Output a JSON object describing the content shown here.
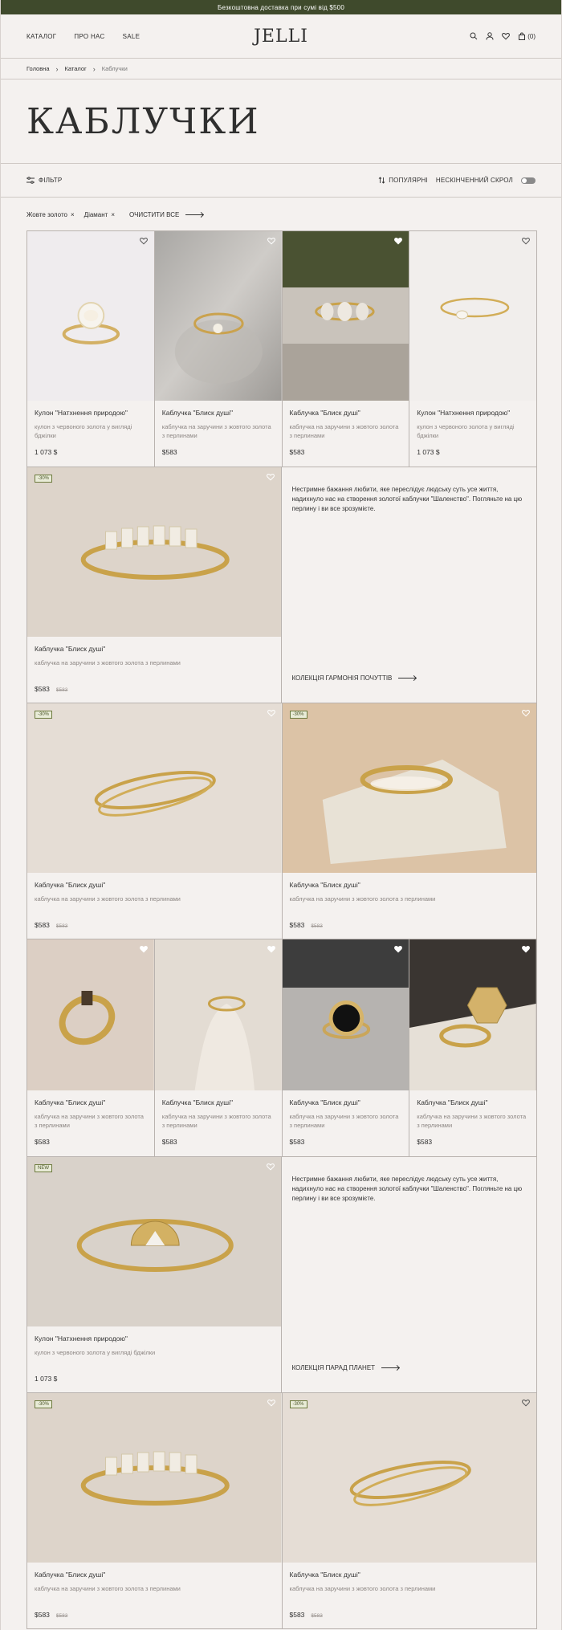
{
  "topbar": {
    "text": "Безкоштовна доставка при сумі від $500"
  },
  "header": {
    "nav": [
      "КАТАЛОГ",
      "ПРО НАС",
      "SALE"
    ],
    "logo": "JELLI",
    "cart_count": "(0)",
    "icons": [
      "search-icon",
      "user-icon",
      "heart-icon",
      "bag-icon"
    ]
  },
  "breadcrumbs": [
    "Головна",
    "Каталог",
    "Каблучки"
  ],
  "page_title": "КАБЛУЧКИ",
  "toolbar": {
    "filter_label": "ФІЛЬТР",
    "sort_label": "ПОПУЛЯРНІ",
    "scroll_label": "НЕСКІНЧЕННИЙ СКРОЛ"
  },
  "chips": [
    "Жовте золото",
    "Діамант"
  ],
  "clear_label": "ОЧИСТИТИ ВСЕ",
  "products_row1": [
    {
      "name": "Кулон \"Натхнення природою\"",
      "desc": "кулон з червоного золота у вигляді бджілки",
      "price": "1 073 $"
    },
    {
      "name": "Каблучка \"Блиск душі\"",
      "desc": "каблучка на заручини з жовтого золота з перлинами",
      "price": "$583"
    },
    {
      "name": "Каблучка \"Блиск душі\"",
      "desc": "каблучка на заручини з жовтого золота з перлинами",
      "price": "$583"
    },
    {
      "name": "Кулон \"Натхнення природою\"",
      "desc": "кулон з червоного золота у вигляді бджілки",
      "price": "1 073 $"
    }
  ],
  "product_big1": {
    "badge": "-30%",
    "name": "Каблучка \"Блиск душі\"",
    "desc": "каблучка на заручини з жовтого золота з перлинами",
    "price": "$583",
    "old": "$583"
  },
  "promo1": {
    "text": "Нестримне бажання любити, яке переслідує людську суть усе життя, надихнуло нас на створення золотої каблучки \"Шаленство\". Погляньте на цю перлину і ви все зрозумієте.",
    "link": "КОЛЕКЦІЯ ГАРМОНІЯ ПОЧУТТІВ"
  },
  "products_row3": [
    {
      "badge": "-30%",
      "name": "Каблучка \"Блиск душі\"",
      "desc": "каблучка на заручини з жовтого золота з перлинами",
      "price": "$583",
      "old": "$583"
    },
    {
      "badge": "-30%",
      "name": "Каблучка \"Блиск душі\"",
      "desc": "каблучка на заручини з жовтого золота з перлинами",
      "price": "$583",
      "old": "$583"
    }
  ],
  "products_row4": [
    {
      "name": "Каблучка \"Блиск душі\"",
      "desc": "каблучка на заручини з жовтого золота з перлинами",
      "price": "$583"
    },
    {
      "name": "Каблучка \"Блиск душі\"",
      "desc": "каблучка на заручини з жовтого золота з перлинами",
      "price": "$583"
    },
    {
      "name": "Каблучка \"Блиск душі\"",
      "desc": "каблучка на заручини з жовтого золота з перлинами",
      "price": "$583"
    },
    {
      "name": "Каблучка \"Блиск душі\"",
      "desc": "каблучка на заручини з жовтого золота з перлинами",
      "price": "$583"
    }
  ],
  "product_big2": {
    "badge": "NEW",
    "name": "Кулон \"Натхнення природою\"",
    "desc": "кулон з червоного золота у вигляді бджілки",
    "price": "1 073 $"
  },
  "promo2": {
    "text": "Нестримне бажання любити, яке переслідує людську суть усе життя, надихнуло нас на створення золотої каблучки \"Шаленство\". Погляньте на цю перлину і ви все зрозумієте.",
    "link": "КОЛЕКЦІЯ ПАРАД ПЛАНЕТ"
  },
  "products_row6": [
    {
      "badge": "-30%",
      "name": "Каблучка \"Блиск душі\"",
      "desc": "каблучка на заручини з жовтого золота з перлинами",
      "price": "$583",
      "old": "$583"
    },
    {
      "badge": "-30%",
      "name": "Каблучка \"Блиск душі\"",
      "desc": "каблучка на заручини з жовтого золота з перлинами",
      "price": "$583",
      "old": "$583"
    }
  ],
  "colors": {
    "topbar": "#3f4a2c",
    "background": "#f4f1ef",
    "gold": "#c9a24a"
  }
}
